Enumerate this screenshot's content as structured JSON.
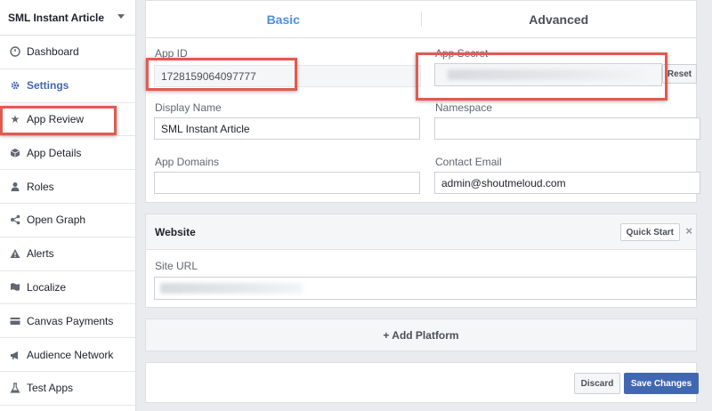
{
  "sidebar": {
    "app_name": "SML Instant Article",
    "items": [
      {
        "label": "Dashboard",
        "icon": "dashboard-icon"
      },
      {
        "label": "Settings",
        "icon": "gear-icon"
      },
      {
        "label": "App Review",
        "icon": "star-icon"
      },
      {
        "label": "App Details",
        "icon": "cube-icon"
      },
      {
        "label": "Roles",
        "icon": "person-icon"
      },
      {
        "label": "Open Graph",
        "icon": "graph-icon"
      },
      {
        "label": "Alerts",
        "icon": "warning-icon"
      },
      {
        "label": "Localize",
        "icon": "flag-icon"
      },
      {
        "label": "Canvas Payments",
        "icon": "card-icon"
      },
      {
        "label": "Audience Network",
        "icon": "megaphone-icon"
      },
      {
        "label": "Test Apps",
        "icon": "flask-icon"
      }
    ],
    "active_index": 1
  },
  "tabs": {
    "basic": "Basic",
    "advanced": "Advanced"
  },
  "basic": {
    "app_id_label": "App ID",
    "app_id_value": "1728159064097777",
    "app_secret_label": "App Secret",
    "reset_label": "Reset",
    "display_name_label": "Display Name",
    "display_name_value": "SML Instant Article",
    "namespace_label": "Namespace",
    "namespace_value": "",
    "app_domains_label": "App Domains",
    "app_domains_value": "",
    "contact_email_label": "Contact Email",
    "contact_email_value": "admin@shoutmeloud.com"
  },
  "website": {
    "title": "Website",
    "quick_start": "Quick Start",
    "close": "×",
    "site_url_label": "Site URL"
  },
  "add_platform": "+ Add Platform",
  "footer": {
    "discard": "Discard",
    "save": "Save Changes"
  },
  "colors": {
    "accent": "#4267b2",
    "tab_active": "#4a90e2",
    "highlight": "#e25a4f"
  }
}
